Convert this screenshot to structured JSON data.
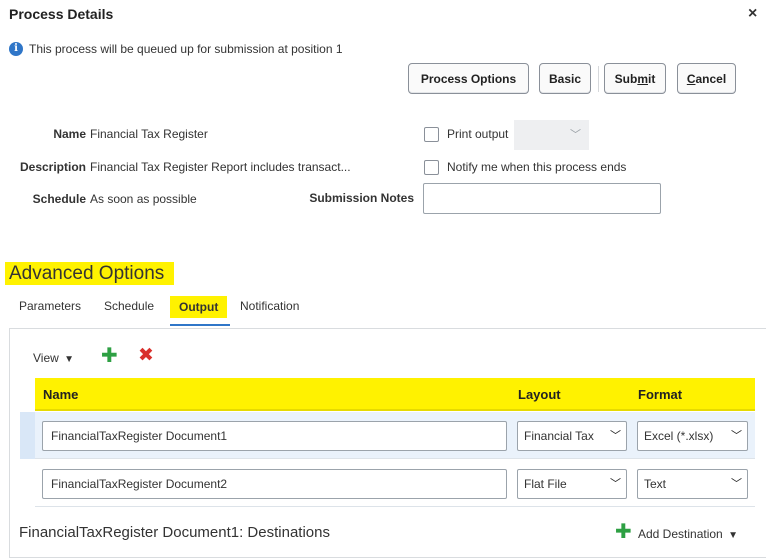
{
  "dialog": {
    "title": "Process Details",
    "close_glyph": "×",
    "info_icon": "info-icon",
    "info_message": "This process will be queued up for submission at position 1"
  },
  "buttons": {
    "process_options": "Process Options",
    "basic": "Basic",
    "submit_pre": "Sub",
    "submit_mn": "m",
    "submit_post": "it",
    "cancel_mn": "C",
    "cancel_post": "ancel"
  },
  "details": {
    "name_label": "Name",
    "name_value": "Financial Tax Register",
    "description_label": "Description",
    "description_value": "Financial Tax Register Report includes transact...",
    "schedule_label": "Schedule",
    "schedule_value": "As soon as possible",
    "submission_notes_label": "Submission Notes",
    "submission_notes_value": "",
    "print_output_label": "Print output",
    "print_output_checked": false,
    "notify_label": "Notify me when this process ends",
    "notify_checked": false
  },
  "advanced": {
    "title": "Advanced Options",
    "tabs": [
      {
        "label": "Parameters"
      },
      {
        "label": "Schedule"
      },
      {
        "label": "Output",
        "selected": true
      },
      {
        "label": "Notification"
      }
    ]
  },
  "output": {
    "toolbar": {
      "view_label": "View",
      "view_arrow": "▼",
      "add_icon": "plus-icon",
      "delete_icon": "delete-icon"
    },
    "columns": [
      "Name",
      "Layout",
      "Format"
    ],
    "rows": [
      {
        "name": "FinancialTaxRegister Document1",
        "layout": "Financial Tax",
        "format": "Excel (*.xlsx)"
      },
      {
        "name": "FinancialTaxRegister Document2",
        "layout": "Flat File",
        "format": "Text"
      }
    ],
    "destinations_title": "FinancialTaxRegister Document1: Destinations",
    "add_destination_label": "Add Destination",
    "add_destination_arrow": "▼"
  },
  "colors": {
    "highlight": "#fff200",
    "accent_blue": "#2f76c8",
    "add_green": "#2ea043",
    "delete_red": "#d9302c",
    "selected_row": "#eaf2fb"
  }
}
